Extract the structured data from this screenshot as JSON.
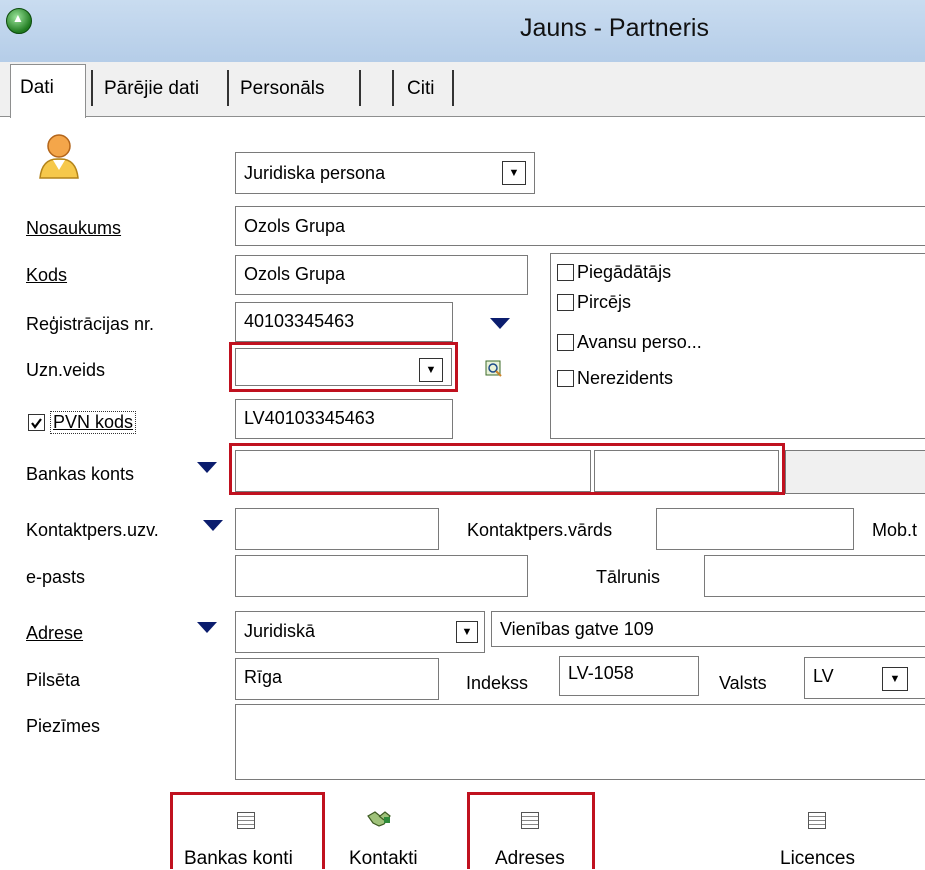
{
  "window": {
    "title": "Jauns - Partneris"
  },
  "tabs": [
    {
      "label": "Dati",
      "active": true
    },
    {
      "label": "Pārējie dati"
    },
    {
      "label": "Personāls"
    },
    {
      "label": ""
    },
    {
      "label": "Citi"
    }
  ],
  "form": {
    "person_type": "Juridiska persona",
    "nosaukums": {
      "label": "Nosaukums",
      "value": "Ozols Grupa"
    },
    "kods": {
      "label": "Kods",
      "value": "Ozols Grupa"
    },
    "reg_nr": {
      "label": "Reģistrācijas nr.",
      "value": "40103345463"
    },
    "uzn_veids": {
      "label": "Uzn.veids",
      "value": ""
    },
    "pvn": {
      "label": "PVN kods",
      "checked": true,
      "value": "LV40103345463"
    },
    "bankas_konts": {
      "label": "Bankas konts",
      "value1": "",
      "value2": ""
    },
    "roles": [
      {
        "label": "Piegādātājs",
        "checked": false
      },
      {
        "label": "Pircējs",
        "checked": false
      },
      {
        "label": "Avansu perso...",
        "checked": false
      },
      {
        "label": "Nerezidents",
        "checked": false
      }
    ],
    "kontakt_uzv": {
      "label": "Kontaktpers.uzv.",
      "value": ""
    },
    "kontakt_vards": {
      "label": "Kontaktpers.vārds",
      "value": ""
    },
    "mob_label": "Mob.t",
    "epasts": {
      "label": "e-pasts",
      "value": ""
    },
    "talrunis": {
      "label": "Tālrunis",
      "value": ""
    },
    "adrese": {
      "label": "Adrese",
      "type": "Juridiskā",
      "value": "Vienības gatve 109"
    },
    "pilseta": {
      "label": "Pilsēta",
      "value": "Rīga"
    },
    "indekss": {
      "label": "Indekss",
      "value": "LV-1058"
    },
    "valsts": {
      "label": "Valsts",
      "value": "LV"
    },
    "piezimes": {
      "label": "Piezīmes",
      "value": ""
    }
  },
  "buttons": {
    "bankas_konti": "Bankas konti",
    "kontakti": "Kontakti",
    "adreses": "Adreses",
    "licences": "Licences"
  },
  "colors": {
    "highlight": "#c0111f",
    "arrow": "#0b1d6e"
  }
}
